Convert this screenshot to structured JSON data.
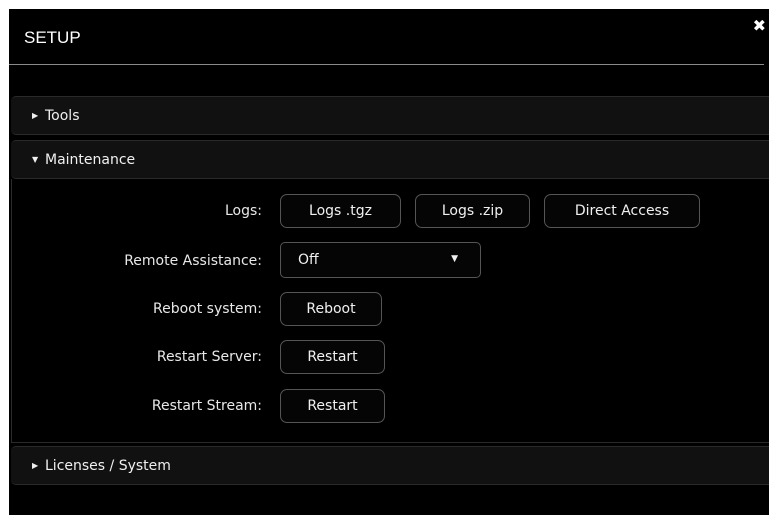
{
  "dialog": {
    "title": "SETUP",
    "close_label": "✖"
  },
  "sections": {
    "tools": {
      "arrow": "▶",
      "label": "Tools"
    },
    "maintenance": {
      "arrow": "▼",
      "label": "Maintenance"
    },
    "licenses": {
      "arrow": "▶",
      "label": "Licenses / System"
    }
  },
  "maintenance": {
    "logs": {
      "label": "Logs:",
      "btn_tgz": "Logs .tgz",
      "btn_zip": "Logs .zip",
      "btn_direct": "Direct Access"
    },
    "remote_assistance": {
      "label": "Remote Assistance:",
      "value": "Off",
      "caret": "▼"
    },
    "reboot": {
      "label": "Reboot system:",
      "button": "Reboot"
    },
    "restart_server": {
      "label": "Restart Server:",
      "button": "Restart"
    },
    "restart_stream": {
      "label": "Restart Stream:",
      "button": "Restart"
    }
  }
}
